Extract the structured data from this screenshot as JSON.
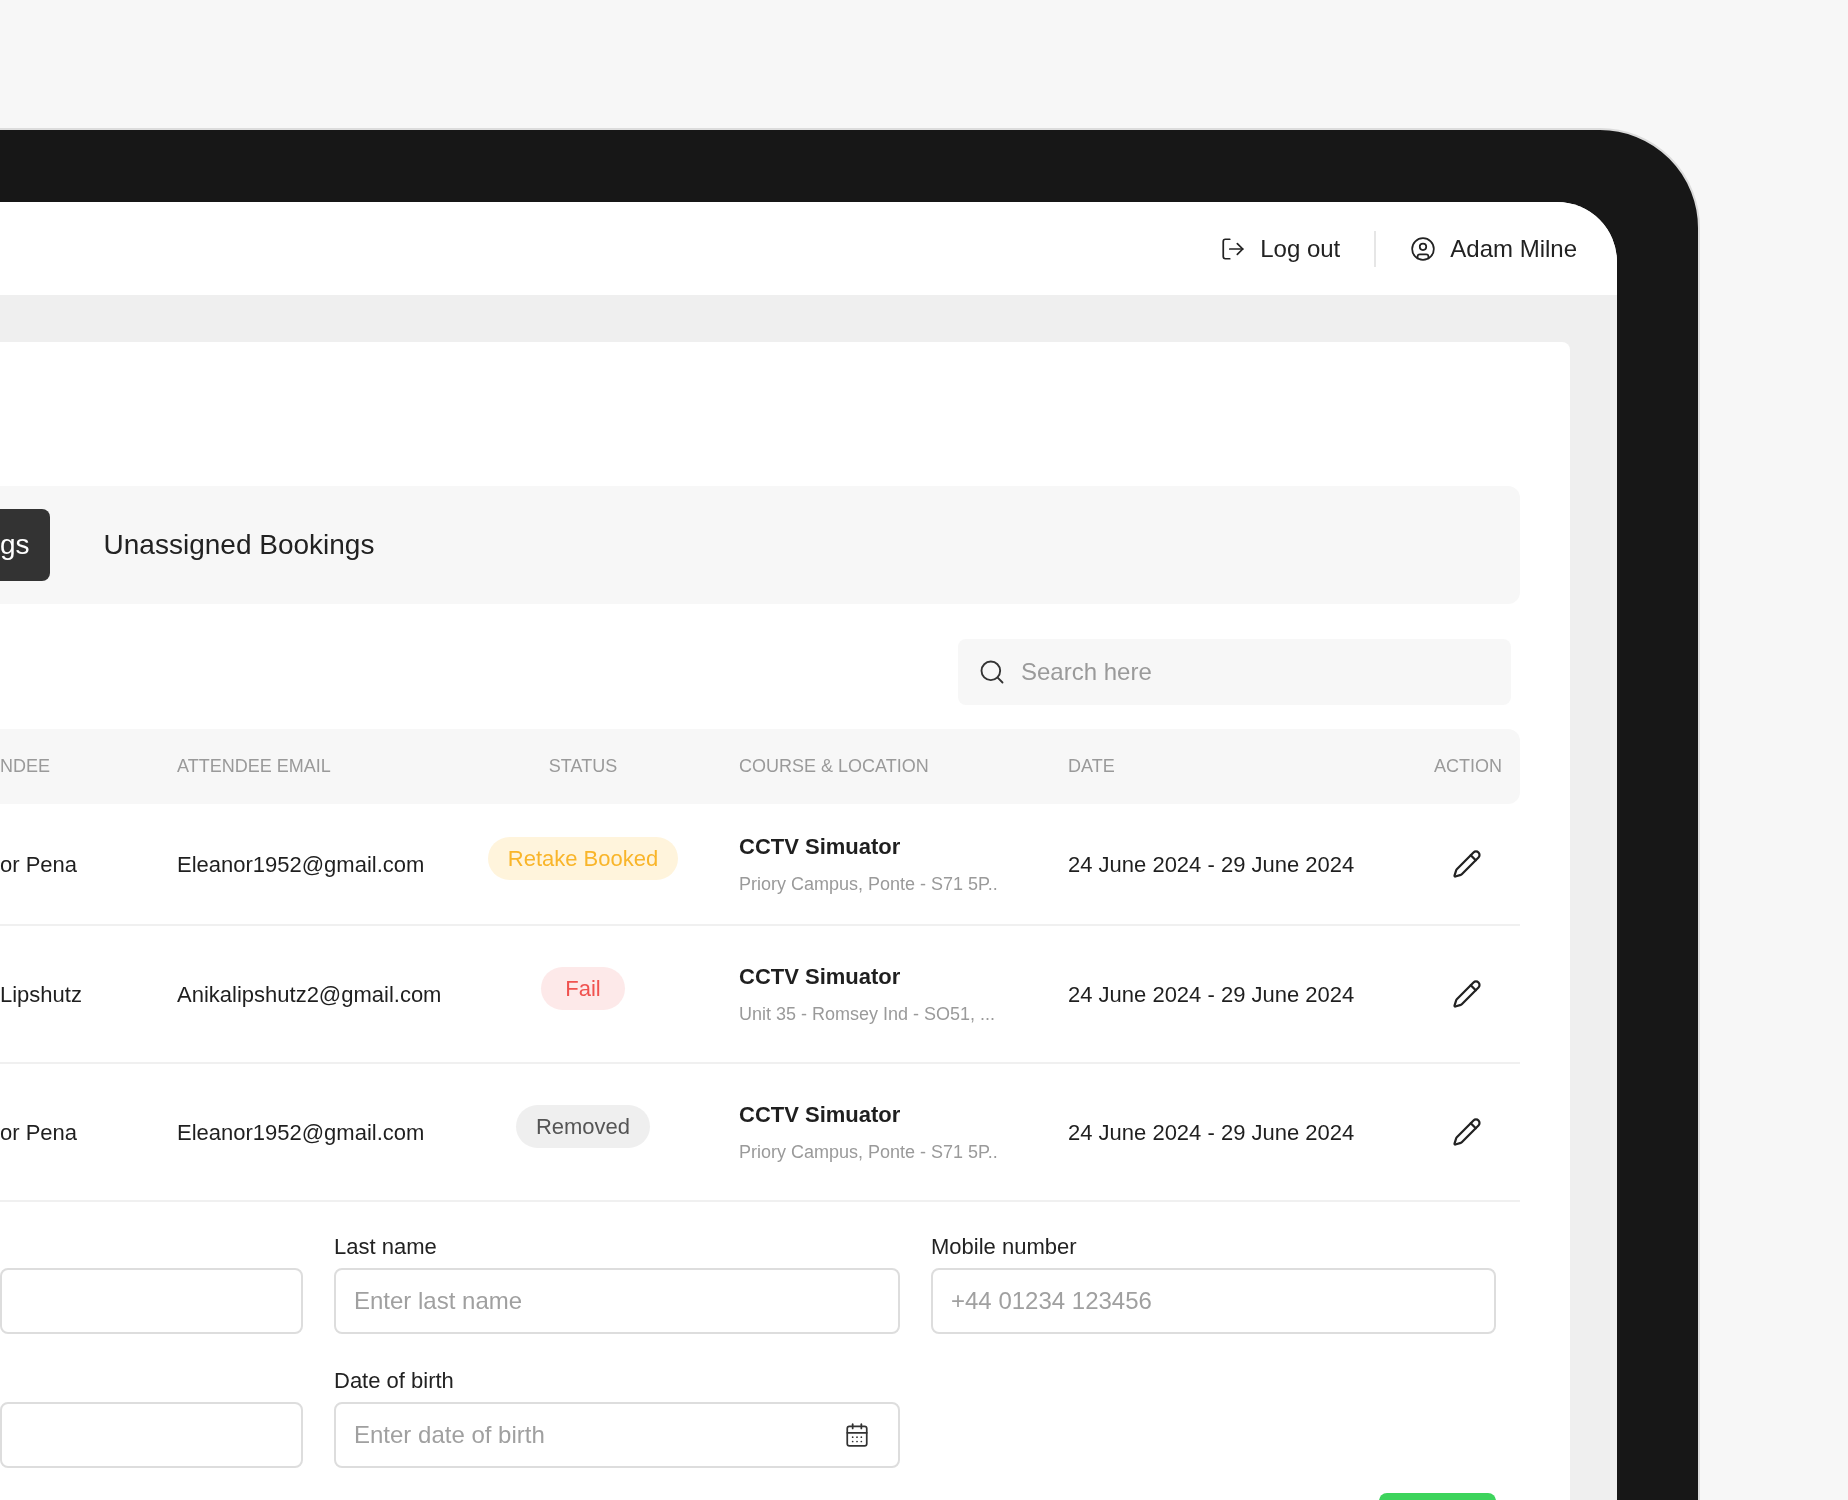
{
  "header": {
    "actions": [
      {
        "kind": "logout",
        "label": "Log out"
      },
      {
        "kind": "user",
        "label": "Adam Milne"
      }
    ]
  },
  "tabs": [
    {
      "label": "gs",
      "selected": true
    },
    {
      "label": "Unassigned Bookings",
      "selected": false
    }
  ],
  "search": {
    "placeholder": "Search here"
  },
  "table": {
    "columns": [
      "NDEE",
      "ATTENDEE EMAIL",
      "STATUS",
      "COURSE & LOCATION",
      "DATE",
      "ACTION"
    ],
    "rows": [
      {
        "attendee": "or Pena",
        "email": "Eleanor1952@gmail.com",
        "status": {
          "label": "Retake Booked",
          "kind": "retake"
        },
        "course": "CCTV Simuator",
        "location": "Priory Campus, Ponte - S71 5P..",
        "date": "24 June 2024 - 29 June 2024"
      },
      {
        "attendee": "Lipshutz",
        "email": "Anikalipshutz2@gmail.com",
        "status": {
          "label": "Fail",
          "kind": "fail"
        },
        "course": "CCTV Simuator",
        "location": "Unit 35 - Romsey Ind - SO51, ...",
        "date": "24 June 2024 - 29 June 2024"
      },
      {
        "attendee": "or Pena",
        "email": "Eleanor1952@gmail.com",
        "status": {
          "label": "Removed",
          "kind": "removed"
        },
        "course": "CCTV Simuator",
        "location": "Priory Campus, Ponte - S71 5P..",
        "date": "24 June 2024 - 29 June 2024"
      }
    ]
  },
  "form": {
    "fields": [
      {
        "kind": "text"
      },
      {
        "kind": "text",
        "label": "Last name",
        "placeholder": "Enter last name"
      },
      {
        "kind": "text",
        "label": "Mobile number",
        "placeholder": "+44 01234 123456"
      },
      {
        "kind": "text"
      },
      {
        "kind": "date",
        "label": "Date of birth",
        "placeholder": "Enter date of birth"
      }
    ]
  }
}
